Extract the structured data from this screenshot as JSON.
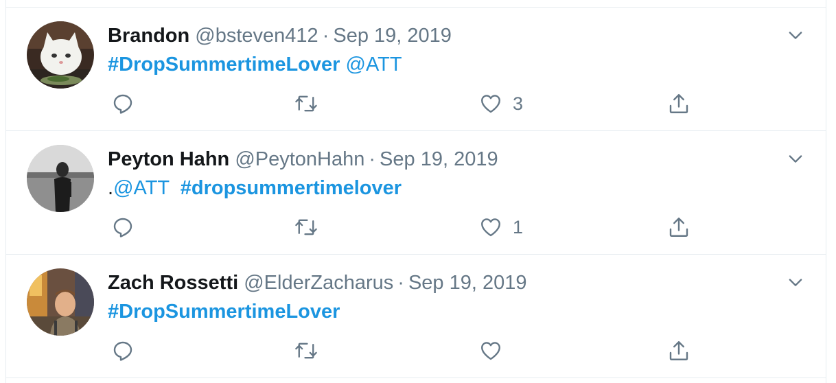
{
  "colors": {
    "link": "#1b95e0",
    "secondary_text": "#657786",
    "primary_text": "#14171a",
    "divider": "#e6ecf0",
    "icon": "#657786"
  },
  "tweets": [
    {
      "author_name": "Brandon",
      "handle": "@bsteven412",
      "separator": "·",
      "date": "Sep 19, 2019",
      "body": {
        "prefix": "",
        "hashtag": "#DropSummertimeLover",
        "mention": "@ATT",
        "order": "hashtag-first"
      },
      "actions": {
        "reply_count": "",
        "retweet_count": "",
        "like_count": "3"
      },
      "icons": [
        "reply-icon",
        "retweet-icon",
        "heart-icon",
        "share-icon",
        "chevron-down-icon"
      ]
    },
    {
      "author_name": "Peyton Hahn",
      "handle": "@PeytonHahn",
      "separator": "·",
      "date": "Sep 19, 2019",
      "body": {
        "prefix": ".",
        "mention": "@ATT",
        "hashtag": "#dropsummertimelover",
        "order": "mention-first"
      },
      "actions": {
        "reply_count": "",
        "retweet_count": "",
        "like_count": "1"
      },
      "icons": [
        "reply-icon",
        "retweet-icon",
        "heart-icon",
        "share-icon",
        "chevron-down-icon"
      ]
    },
    {
      "author_name": "Zach Rossetti",
      "handle": "@ElderZacharus",
      "separator": "·",
      "date": "Sep 19, 2019",
      "body": {
        "prefix": "",
        "hashtag": "#DropSummertimeLover",
        "mention": "",
        "order": "hashtag-first"
      },
      "actions": {
        "reply_count": "",
        "retweet_count": "",
        "like_count": ""
      },
      "icons": [
        "reply-icon",
        "retweet-icon",
        "heart-icon",
        "share-icon",
        "chevron-down-icon"
      ]
    }
  ]
}
